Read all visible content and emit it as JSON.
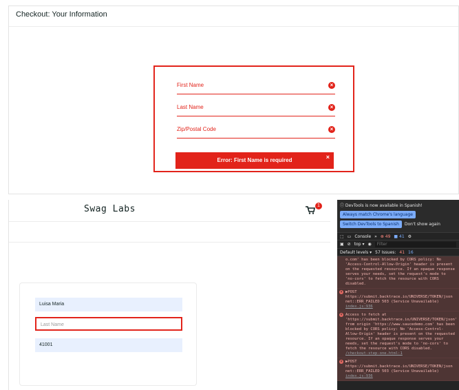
{
  "top": {
    "title": "Checkout: Your Information",
    "fields": [
      "First Name",
      "Last Name",
      "Zip/Postal Code"
    ],
    "error": "Error: First Name is required",
    "close": "×"
  },
  "app": {
    "logo": "Swag Labs",
    "cart_badge": "1",
    "first_name": "Luisa Maria",
    "last_name_placeholder": "Last Name",
    "zip": "41001"
  },
  "devtools": {
    "info": "DevTools is now available in Spanish!",
    "btn_match": "Always match Chrome's language",
    "btn_switch": "Switch DevTools to Spanish",
    "btn_dismiss": "Don't show again",
    "tab_console": "Console",
    "more": "»",
    "errors": "49",
    "warnings": "41",
    "context": "top ▾",
    "filter_placeholder": "Filter",
    "levels": "Default levels ▾",
    "issues_label": "57 Issues:",
    "issues_warn": "41",
    "issues_info": "16",
    "logs": [
      {
        "text": "o.com' has been blocked by CORS policy: No 'Access-Control-Allow-Origin' header is present on the requested resource. If an opaque response serves your needs, set the request's mode to 'no-cors' to fetch the resource with CORS disabled.",
        "src": ""
      },
      {
        "text": "▶POST https://submit.backtrace.io/UNIVERSE/TOKEN/json net::ERR_FAILED 503 (Service Unavailable)",
        "src": "index.js:936"
      },
      {
        "text": "Access to fetch at 'https://submit.backtrace.io/UNIVERSE/TOKEN/json' from origin 'https://www.saucedemo.com' has been blocked by CORS policy: No 'Access-Control-Allow-Origin' header is present on the requested resource. If an opaque response serves your needs, set the request's mode to 'no-cors' to fetch the resource with CORS disabled.",
        "src": "/checkout-step-one.html:1"
      },
      {
        "text": "▶POST https://submit.backtrace.io/UNIVERSE/TOKEN/json net::ERR_FAILED 503 (Service Unavailable)",
        "src": "index.js:936"
      }
    ]
  },
  "colors": {
    "accent_red": "#e2231a",
    "autofill_blue": "#e8f0fe",
    "devtools_bg": "#242424",
    "error_log_bg": "#4e3534"
  }
}
